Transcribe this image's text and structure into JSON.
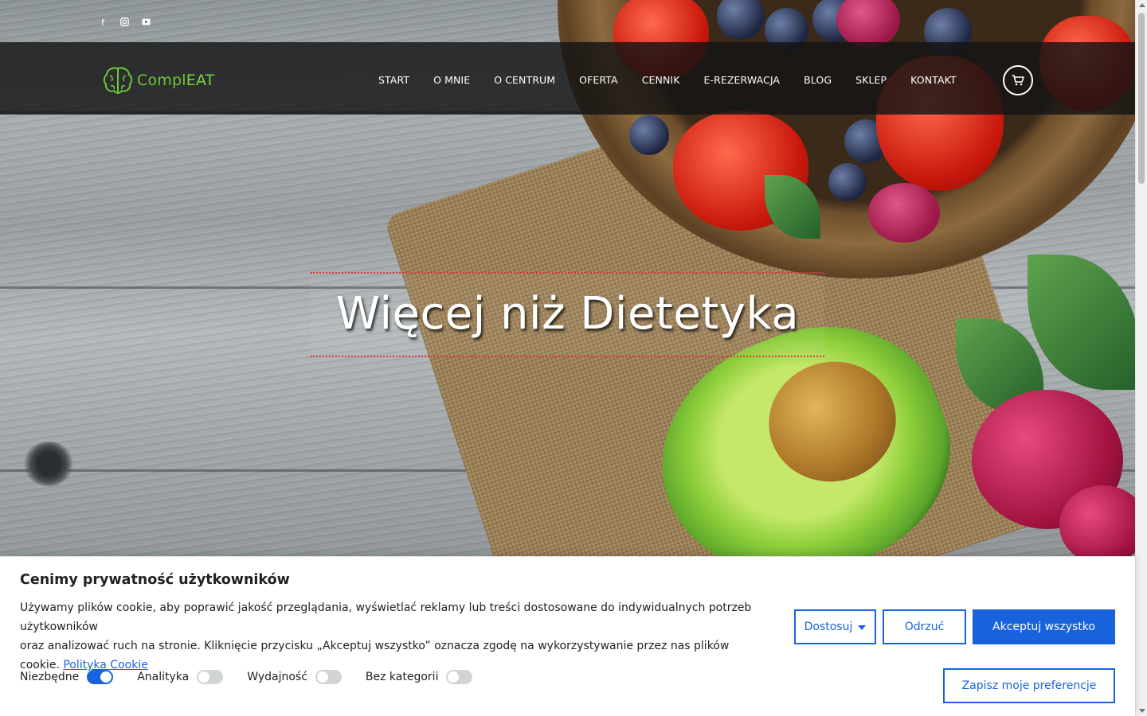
{
  "social": {
    "facebook_icon": "facebook-icon",
    "instagram_icon": "instagram-icon",
    "youtube_icon": "youtube-icon"
  },
  "header": {
    "logo_prefix": "Compl",
    "logo_suffix": "EAT",
    "nav": [
      {
        "label": "START"
      },
      {
        "label": "O MNIE"
      },
      {
        "label": "O CENTRUM"
      },
      {
        "label": "OFERTA"
      },
      {
        "label": "CENNIK"
      },
      {
        "label": "E-REZERWACJA"
      },
      {
        "label": "BLOG"
      },
      {
        "label": "SKLEP"
      },
      {
        "label": "KONTAKT"
      }
    ],
    "cart_icon": "cart-icon"
  },
  "hero": {
    "title": "Więcej niż Dietetyka"
  },
  "cookie": {
    "title": "Cenimy prywatność użytkowników",
    "description_line1": "Używamy plików cookie, aby poprawić jakość przeglądania, wyświetlać reklamy lub treści dostosowane do indywidualnych potrzeb użytkowników",
    "description_line2": "oraz analizować ruch na stronie. Kliknięcie przycisku „Akceptuj wszystko” oznacza zgodę na wykorzystywanie przez nas plików",
    "description_line3": "cookie.",
    "policy_link": "Polityka Cookie",
    "customize_label": "Dostosuj",
    "reject_label": "Odrzuć",
    "accept_label": "Akceptuj wszystko",
    "save_label": "Zapisz moje preferencje",
    "toggles": [
      {
        "label": "Niezbędne",
        "enabled": true
      },
      {
        "label": "Analityka",
        "enabled": false
      },
      {
        "label": "Wydajność",
        "enabled": false
      },
      {
        "label": "Bez kategorii",
        "enabled": false
      }
    ]
  },
  "colors": {
    "accent": "#1863dc",
    "logo_green": "#6cc43b",
    "hero_border": "#d63939"
  }
}
